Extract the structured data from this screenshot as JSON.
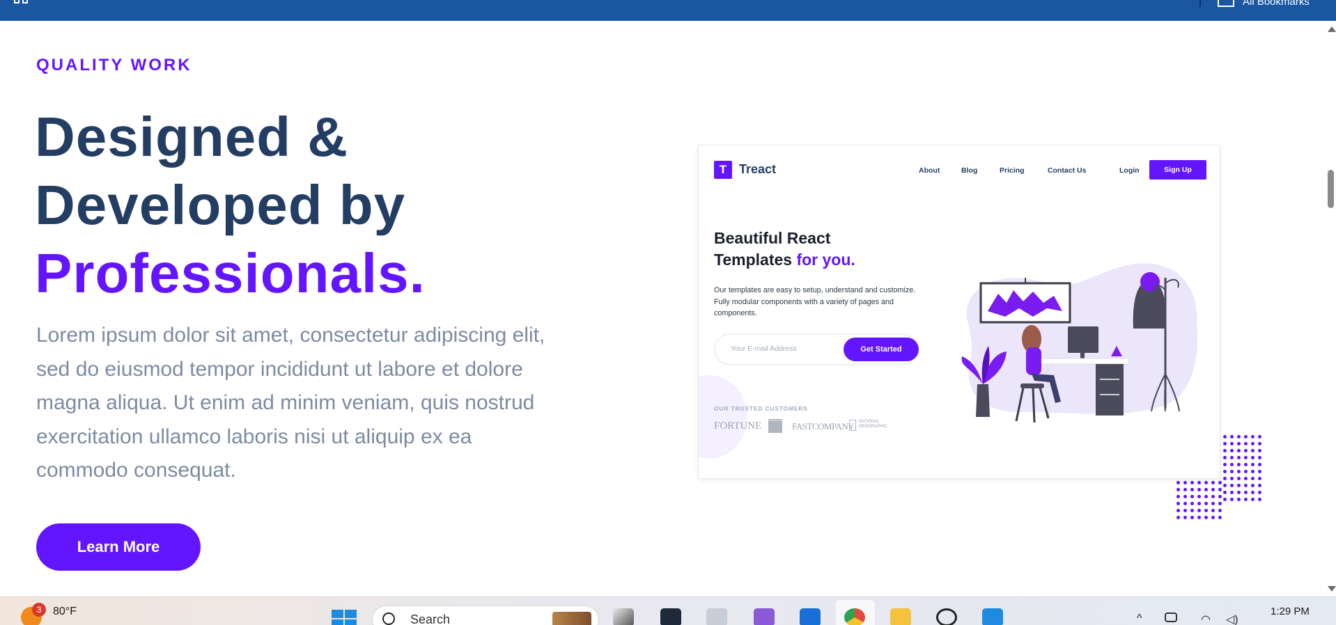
{
  "browser": {
    "bookmarks_label": "All Bookmarks"
  },
  "hero": {
    "eyebrow": "QUALITY WORK",
    "headline_line1": "Designed &",
    "headline_line2": "Developed by",
    "headline_accent": "Professionals.",
    "description": "Lorem ipsum dolor sit amet, consectetur adipiscing elit, sed do eiusmod tempor incididunt ut labore et dolore magna aliqua. Ut enim ad minim veniam, quis nostrud exercitation ullamco laboris nisi ut aliquip ex ea commodo consequat.",
    "cta_label": "Learn More",
    "accent_color": "#6415ff",
    "heading_color": "#243e63"
  },
  "preview": {
    "logo_letter": "T",
    "brand": "Treact",
    "nav": [
      "About",
      "Blog",
      "Pricing",
      "Contact Us"
    ],
    "login_label": "Login",
    "signup_label": "Sign Up",
    "title_line1": "Beautiful React",
    "title_line2": "Templates",
    "title_accent": "for you.",
    "description": "Our templates are easy to setup, understand and customize. Fully modular components with a variety of pages and components.",
    "email_placeholder": "Your E-mail Address",
    "get_started_label": "Get Started",
    "trusted_label": "OUR TRUSTED CUSTOMERS",
    "customer_logos": [
      "FORTUNE",
      "The Boston Globe",
      "FASTCOMPANY",
      "NATIONAL GEOGRAPHIC"
    ]
  },
  "taskbar": {
    "weather_badge": "3",
    "weather_temp": "80°F",
    "search_label": "Search",
    "clock": "1:29 PM",
    "apps": [
      "file-explorer-icon",
      "terminal-icon",
      "dev-tools-icon",
      "visual-studio-icon",
      "outlook-icon",
      "chrome-icon",
      "folder-icon",
      "chatgpt-icon",
      "vscode-icon"
    ]
  }
}
